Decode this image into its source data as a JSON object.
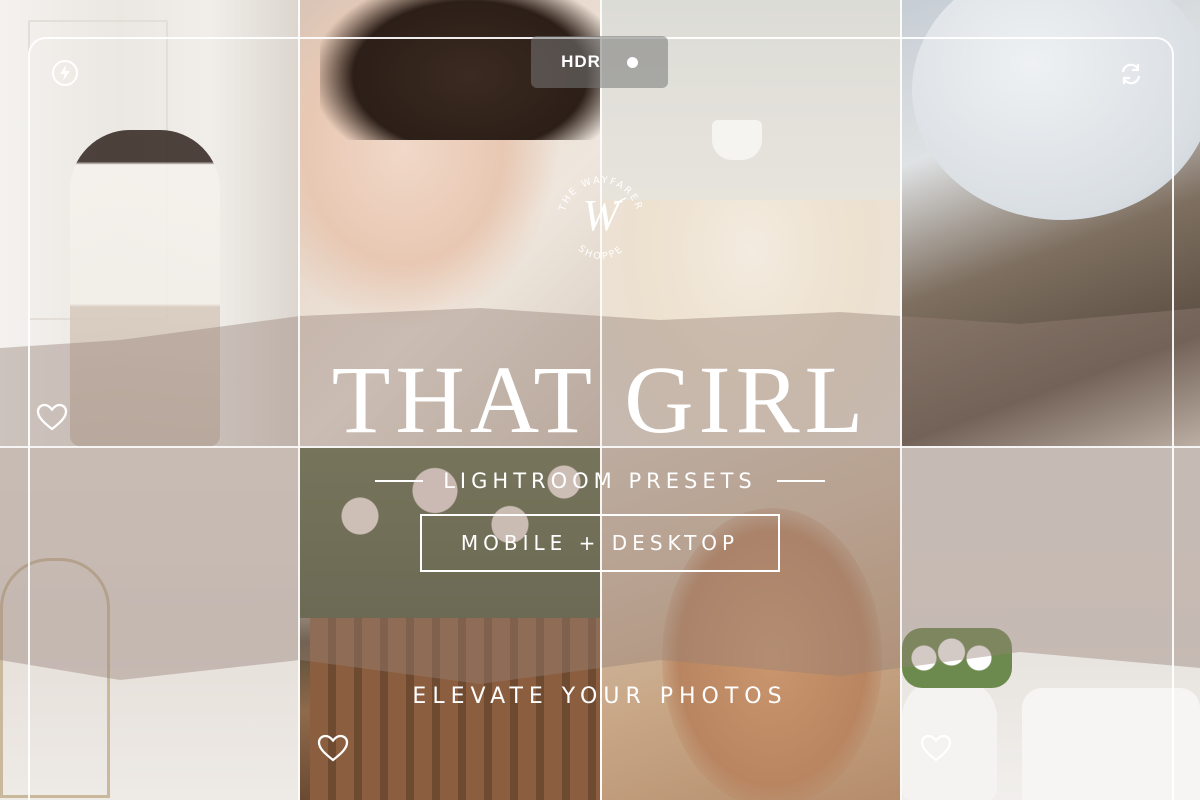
{
  "camera": {
    "hdr_label": "HDR",
    "flash_icon": "flash-auto-icon",
    "switch_icon": "camera-switch-icon"
  },
  "brand": {
    "seal_text": "THE WAYFARER SHOPPE",
    "seal_monogram": "W"
  },
  "promo": {
    "title": "THAT GIRL",
    "subtitle": "LIGHTROOM PRESETS",
    "badge": "MOBILE + DESKTOP",
    "tagline": "ELEVATE YOUR PHOTOS"
  },
  "icons": [
    "heart-icon",
    "flash-auto-icon",
    "camera-switch-icon"
  ],
  "colors": {
    "text": "#ffffff",
    "band_overlay": "#968078",
    "background": "#e9e4df"
  }
}
